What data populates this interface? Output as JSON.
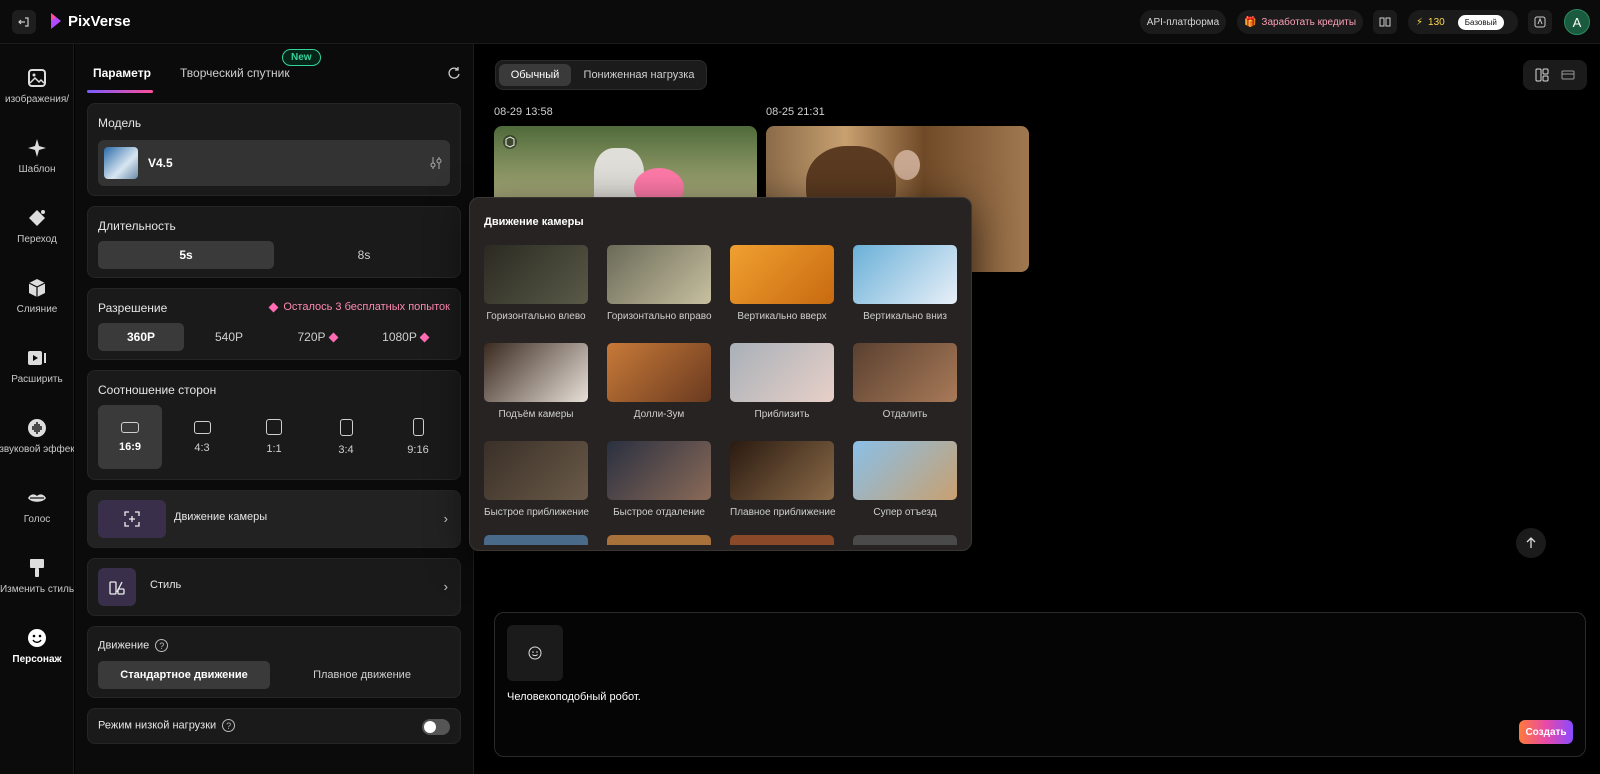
{
  "topbar": {
    "brand": "PixVerse",
    "api_label": "API-платформа",
    "earn_label": "Заработать кредиты",
    "credits": "130",
    "plan": "Базовый",
    "avatar_letter": "A"
  },
  "rail": {
    "items": [
      {
        "label": "изображения/",
        "icon": "image-icon"
      },
      {
        "label": "Шаблон",
        "icon": "sparkle-icon"
      },
      {
        "label": "Переход",
        "icon": "transition-icon"
      },
      {
        "label": "Слияние",
        "icon": "cube-icon"
      },
      {
        "label": "Расширить",
        "icon": "extend-icon"
      },
      {
        "label": "звуковой эффек",
        "icon": "sound-icon"
      },
      {
        "label": "Голос",
        "icon": "lips-icon"
      },
      {
        "label": "Изменить стиль",
        "icon": "brush-icon"
      },
      {
        "label": "Персонаж",
        "icon": "smiley-icon",
        "active": true
      }
    ]
  },
  "panel": {
    "tabs": [
      "Параметр",
      "Творческий спутник"
    ],
    "new_badge": "New",
    "model": {
      "title": "Модель",
      "value": "V4.5"
    },
    "duration": {
      "title": "Длительность",
      "options": [
        "5s",
        "8s"
      ],
      "selected": "5s"
    },
    "resolution": {
      "title": "Разрешение",
      "note": "Осталось 3 бесплатных попыток",
      "options": [
        "360P",
        "540P",
        "720P",
        "1080P"
      ],
      "selected": "360P"
    },
    "aspect": {
      "title": "Соотношение сторон",
      "options": [
        "16:9",
        "4:3",
        "1:1",
        "3:4",
        "9:16"
      ],
      "selected": "16:9"
    },
    "camera_motion": {
      "label": "Движение камеры"
    },
    "style": {
      "label": "Стиль"
    },
    "motion": {
      "title": "Движение",
      "options": [
        "Стандартное движение",
        "Плавное движение"
      ],
      "selected": "Стандартное движение"
    },
    "low_load": {
      "label": "Режим низкой нагрузки",
      "enabled": false
    }
  },
  "main": {
    "modes": [
      "Обычный",
      "Пониженная нагрузка"
    ],
    "selected_mode": "Обычный",
    "items": [
      {
        "date": "08-29 13:58"
      },
      {
        "date": "08-25 21:31"
      }
    ],
    "prompt": "Человекоподобный робот.",
    "create_label": "Создать"
  },
  "popover": {
    "title": "Движение камеры",
    "options": [
      {
        "label": "Горизонтально влево",
        "colors": [
          "#2a2a22",
          "#5a5a48"
        ]
      },
      {
        "label": "Горизонтально вправо",
        "colors": [
          "#6a6a58",
          "#c8c0a0"
        ]
      },
      {
        "label": "Вертикально вверх",
        "colors": [
          "#f0a030",
          "#c86a10"
        ]
      },
      {
        "label": "Вертикально вниз",
        "colors": [
          "#6ab0d8",
          "#e8f0f8"
        ]
      },
      {
        "label": "Подъём камеры",
        "colors": [
          "#3a2a20",
          "#e8e0d8"
        ]
      },
      {
        "label": "Долли-Зум",
        "colors": [
          "#c87a38",
          "#6a3a20"
        ]
      },
      {
        "label": "Приблизить",
        "colors": [
          "#a8b0b8",
          "#e8d0c8"
        ]
      },
      {
        "label": "Отдалить",
        "colors": [
          "#5a4030",
          "#a87a58"
        ]
      },
      {
        "label": "Быстрое приближение",
        "colors": [
          "#3a3028",
          "#6a5a48"
        ]
      },
      {
        "label": "Быстрое отдаление",
        "colors": [
          "#2a3040",
          "#8a6a58"
        ]
      },
      {
        "label": "Плавное приближение",
        "colors": [
          "#2a1a10",
          "#8a6a48"
        ]
      },
      {
        "label": "Супер отъезд",
        "colors": [
          "#8ac0e8",
          "#c8a070"
        ]
      }
    ]
  }
}
